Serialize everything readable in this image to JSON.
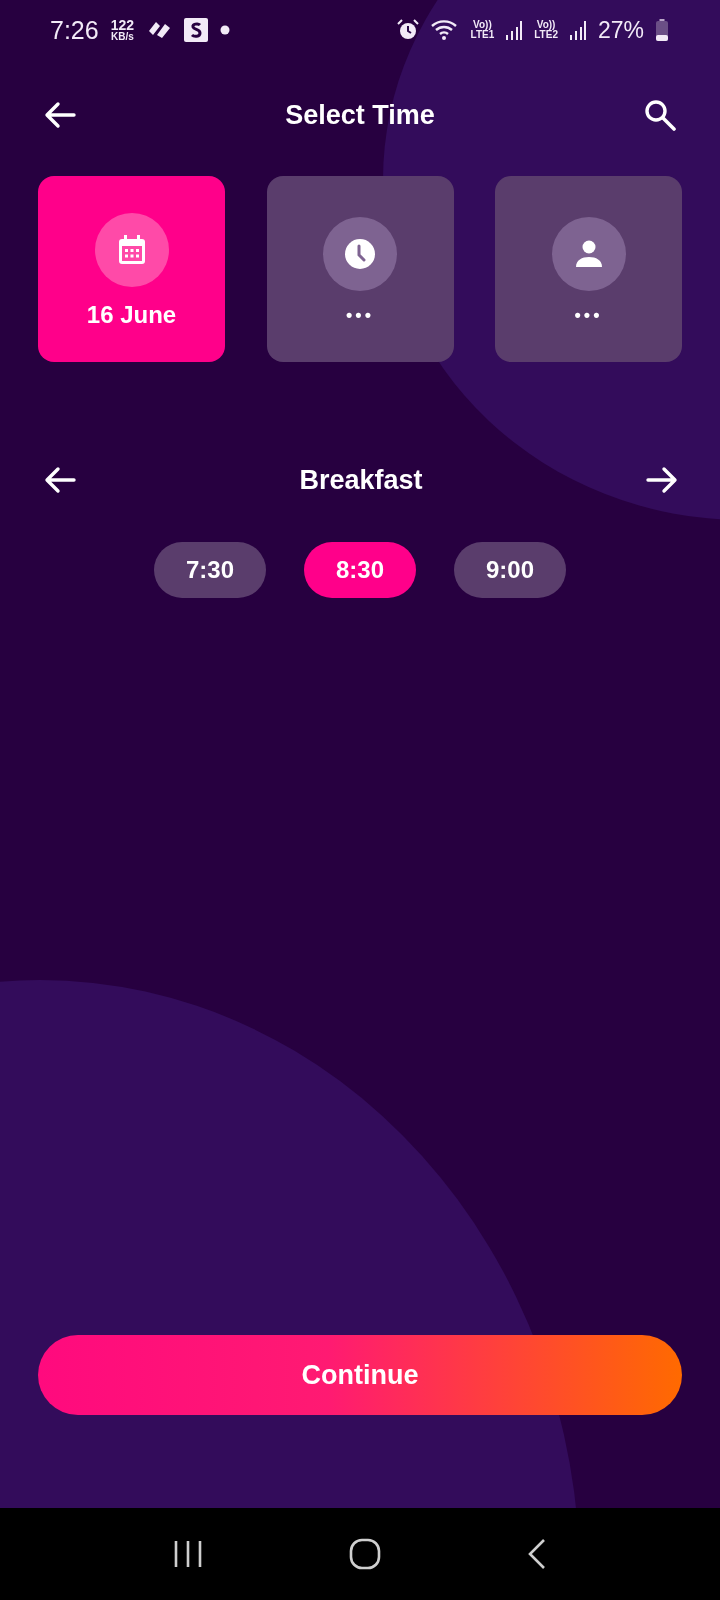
{
  "status_bar": {
    "time": "7:26",
    "speed_value": "122",
    "speed_unit": "KB/s",
    "sim1_top": "Vo))",
    "sim1_bottom": "LTE1",
    "sim2_top": "Vo))",
    "sim2_bottom": "LTE2",
    "battery": "27%"
  },
  "header": {
    "title": "Select Time"
  },
  "steps": [
    {
      "kind": "date",
      "label": "16 June",
      "selected": true
    },
    {
      "kind": "time",
      "label": "•••",
      "selected": false
    },
    {
      "kind": "guests",
      "label": "•••",
      "selected": false
    }
  ],
  "meal": {
    "title": "Breakfast"
  },
  "slots": [
    {
      "label": "7:30",
      "selected": false
    },
    {
      "label": "8:30",
      "selected": true
    },
    {
      "label": "9:00",
      "selected": false
    }
  ],
  "primary_button": "Continue"
}
